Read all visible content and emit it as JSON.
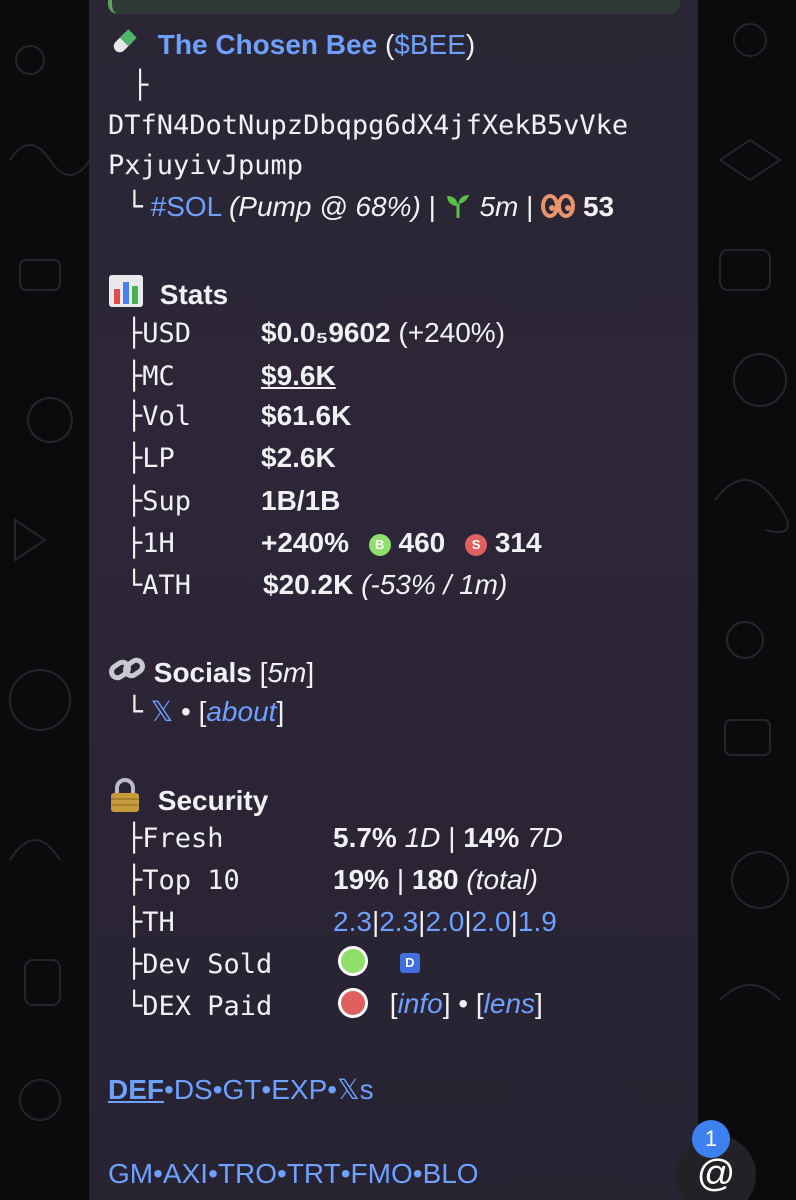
{
  "token": {
    "pill_icon": "pill-icon",
    "name": "The Chosen Bee",
    "ticker_open": "(",
    "ticker": "$BEE",
    "ticker_close": ")",
    "branch_top": "├",
    "address_line1": "DTfN4DotNupzDbqpg6dX4jfXekB5vVke",
    "address_line2": "PxjuyivJpump",
    "branch_end": "└",
    "chain": "#SOL",
    "pump_info": "(Pump @ 68%)",
    "sep": "|",
    "age": "5m",
    "watchers": "53"
  },
  "stats": {
    "title": "Stats",
    "rows": [
      {
        "branch": "├",
        "label": "USD",
        "value": "$0.0₅9602",
        "extra": "(+240%)"
      },
      {
        "branch": "├",
        "label": "MC",
        "value": "$9.6K"
      },
      {
        "branch": "├",
        "label": "Vol",
        "value": "$61.6K"
      },
      {
        "branch": "├",
        "label": "LP",
        "value": "$2.6K"
      },
      {
        "branch": "├",
        "label": "Sup",
        "value": "1B/1B"
      },
      {
        "branch": "├",
        "label": "1H",
        "value": "+240%",
        "buys_icon": "B",
        "buys": "460",
        "sells_icon": "S",
        "sells": "314"
      },
      {
        "branch": "└",
        "label": "ATH",
        "value": "$20.2K",
        "extra": "(-53% / 1m)"
      }
    ]
  },
  "socials": {
    "title": "Socials",
    "age_open": "[",
    "age": "5m",
    "age_close": "]",
    "branch": "└",
    "x_link": "𝕏",
    "dot": "•",
    "about_open": "[",
    "about": "about",
    "about_close": "]"
  },
  "security": {
    "title": "Security",
    "fresh": {
      "branch": "├",
      "label": "Fresh",
      "v1": "5.7%",
      "p1": "1D",
      "sep": "|",
      "v2": "14%",
      "p2": "7D"
    },
    "top10": {
      "branch": "├",
      "label": "Top 10",
      "v1": "19%",
      "sep": "|",
      "v2": "180",
      "note": "(total)"
    },
    "th": {
      "branch": "├",
      "label": "TH",
      "values": [
        "2.3",
        "2.3",
        "2.0",
        "2.0",
        "1.9"
      ],
      "sep": "|"
    },
    "dev_sold": {
      "branch": "├",
      "label": "Dev Sold",
      "status": "green",
      "badge": "D"
    },
    "dex_paid": {
      "branch": "└",
      "label": "DEX Paid",
      "status": "red",
      "info": "info",
      "lens": "lens",
      "dot": "•",
      "open": "[",
      "close": "]"
    }
  },
  "links_row1": [
    "DEF",
    "DS",
    "GT",
    "EXP",
    "𝕏s"
  ],
  "links_row2": [
    "GM",
    "AXI",
    "TRO",
    "TRT",
    "FMO",
    "BLO"
  ],
  "link_sep": "•",
  "fab": {
    "icon": "@",
    "badge": "1"
  },
  "colors": {
    "link": "#6ea0ff",
    "green": "#8ee06a",
    "red": "#e0605f",
    "bubble": "#2a2634"
  }
}
